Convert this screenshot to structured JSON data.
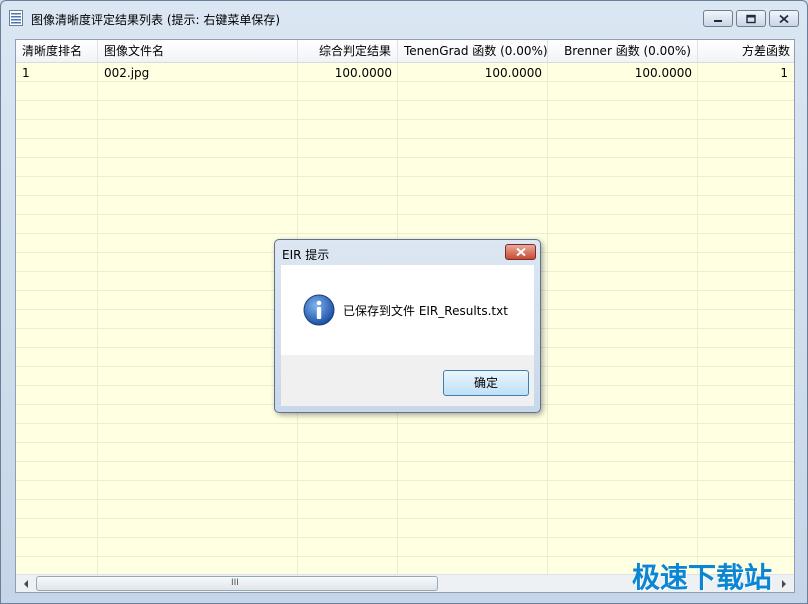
{
  "window": {
    "title": "图像清晰度评定结果列表 (提示: 右键菜单保存)"
  },
  "list": {
    "columns": [
      "清晰度排名",
      "图像文件名",
      "综合判定结果",
      "TenenGrad 函数 (0.00%)",
      "Brenner 函数 (0.00%)",
      "方差函数"
    ],
    "rows": [
      [
        "1",
        "002.jpg",
        "100.0000",
        "100.0000",
        "100.0000",
        "1"
      ]
    ]
  },
  "scrollbar": {
    "grip": "III"
  },
  "dialog": {
    "title": "EIR 提示",
    "message": "已保存到文件 EIR_Results.txt",
    "ok_label": "确定"
  },
  "watermark": {
    "text": "极速下载站"
  },
  "colors": {
    "list_background": "#ffffe1",
    "watermark": "#0b86d3",
    "close_button": "#c74a33"
  }
}
